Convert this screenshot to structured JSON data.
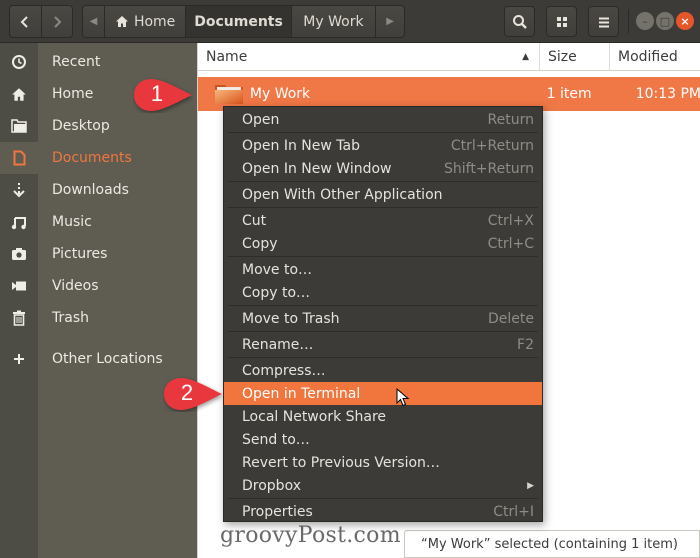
{
  "header": {
    "nav": {
      "back_icon": "chevron-left-icon",
      "forward_icon": "chevron-right-icon"
    },
    "breadcrumb": [
      {
        "label": "Home",
        "icon": "home-icon"
      },
      {
        "label": "Documents",
        "current": true
      },
      {
        "label": "My Work"
      }
    ],
    "buttons": {
      "search": "search-icon",
      "view": "grid-view-icon",
      "menu": "hamburger-menu-icon"
    },
    "window_controls": {
      "minimize": "–",
      "maximize": "□",
      "close": "×"
    }
  },
  "sidebar": {
    "items": [
      {
        "label": "Recent",
        "icon": "clock-icon"
      },
      {
        "label": "Home",
        "icon": "home-icon"
      },
      {
        "label": "Desktop",
        "icon": "folder-icon"
      },
      {
        "label": "Documents",
        "icon": "document-icon",
        "active": true
      },
      {
        "label": "Downloads",
        "icon": "download-icon"
      },
      {
        "label": "Music",
        "icon": "music-icon"
      },
      {
        "label": "Pictures",
        "icon": "camera-icon"
      },
      {
        "label": "Videos",
        "icon": "video-icon"
      },
      {
        "label": "Trash",
        "icon": "trash-icon"
      },
      {
        "label": "Other Locations",
        "icon": "plus-icon"
      }
    ]
  },
  "file_list": {
    "columns": {
      "name": "Name",
      "size": "Size",
      "modified": "Modified"
    },
    "rows": [
      {
        "name": "My Work",
        "size": "1 item",
        "modified": "10:13 PM",
        "selected": true
      }
    ]
  },
  "context_menu": {
    "items": [
      {
        "label": "Open",
        "accel": "Return"
      },
      {
        "separator": true
      },
      {
        "label": "Open In New Tab",
        "accel": "Ctrl+Return"
      },
      {
        "label": "Open In New Window",
        "accel": "Shift+Return"
      },
      {
        "separator": true
      },
      {
        "label": "Open With Other Application",
        "accel": ""
      },
      {
        "separator": true
      },
      {
        "label": "Cut",
        "accel": "Ctrl+X"
      },
      {
        "label": "Copy",
        "accel": "Ctrl+C"
      },
      {
        "separator": true
      },
      {
        "label": "Move to…",
        "accel": ""
      },
      {
        "label": "Copy to…",
        "accel": ""
      },
      {
        "separator": true
      },
      {
        "label": "Move to Trash",
        "accel": "Delete"
      },
      {
        "separator": true
      },
      {
        "label": "Rename…",
        "accel": "F2"
      },
      {
        "separator": true
      },
      {
        "label": "Compress…",
        "accel": ""
      },
      {
        "label": "Open in Terminal",
        "accel": "",
        "highlighted": true
      },
      {
        "label": "Local Network Share",
        "accel": ""
      },
      {
        "label": "Send to…",
        "accel": ""
      },
      {
        "label": "Revert to Previous Version…",
        "accel": ""
      },
      {
        "label": "Dropbox",
        "accel": "",
        "submenu": true
      },
      {
        "separator": true
      },
      {
        "label": "Properties",
        "accel": "Ctrl+I"
      }
    ]
  },
  "status": {
    "text": "“My Work” selected  (containing 1 item)"
  },
  "annotations": {
    "callout_1": "1",
    "callout_2": "2",
    "callout_color": "#e8383d"
  },
  "watermark": "groovyPost.com",
  "colors": {
    "accent": "#f0763e",
    "menu_bg": "#3c3b37",
    "sidebar_bg": "#5f5c52",
    "header_bg": "#3d3b37"
  }
}
